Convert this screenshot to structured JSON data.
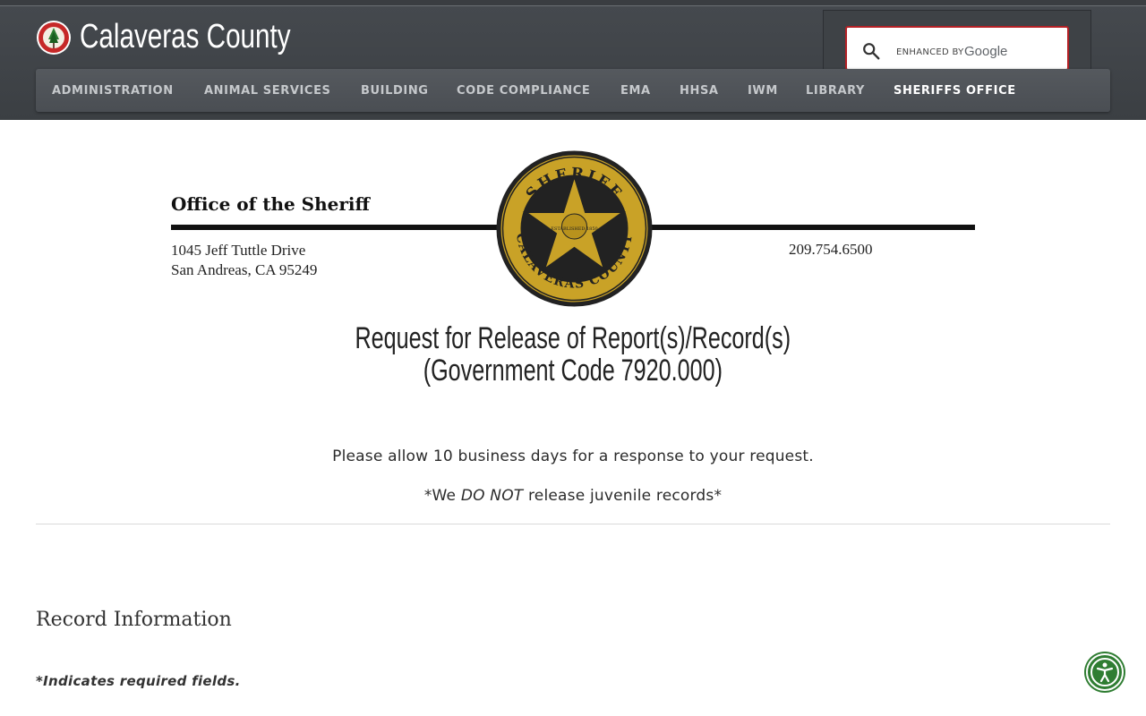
{
  "header": {
    "site_title": "Calaveras County",
    "search": {
      "enhanced_label": "ENHANCED BY",
      "provider": "Google"
    },
    "nav": [
      {
        "label": "ADMINISTRATION"
      },
      {
        "label": "ANIMAL SERVICES"
      },
      {
        "label": "BUILDING"
      },
      {
        "label": "CODE COMPLIANCE"
      },
      {
        "label": "EMA"
      },
      {
        "label": "HHSA"
      },
      {
        "label": "IWM"
      },
      {
        "label": "LIBRARY"
      },
      {
        "label": "SHERIFFS OFFICE",
        "active": true
      }
    ]
  },
  "letterhead": {
    "office": "Office of the Sheriff",
    "address_line1": "1045 Jeff Tuttle Drive",
    "address_line2": "San Andreas, CA 95249",
    "phone": "209.754.6500",
    "badge_top": "SHERIFF",
    "badge_bottom": "CALAVERAS COUNTY",
    "badge_center": "ESTABLISHED 1850"
  },
  "form": {
    "title_line1": "Request for Release of Report(s)/Record(s)",
    "title_line2": "(Government Code 7920.000)",
    "note_business_days": "Please allow 10 business days for a response to your request.",
    "note_juvenile_prefix": "*We ",
    "note_juvenile_emph": "DO NOT",
    "note_juvenile_suffix": " release juvenile records*",
    "section_title": "Record Information",
    "required_note": "*Indicates required fields."
  },
  "colors": {
    "header_bg": "#3b3f43",
    "nav_bg": "#4a4e53",
    "search_border": "#b32025",
    "badge_gold": "#c9a227",
    "accessibility_green": "#2f7d32"
  },
  "icons": {
    "search": "search-icon",
    "county_seal": "county-seal-icon",
    "accessibility": "accessibility-icon"
  }
}
